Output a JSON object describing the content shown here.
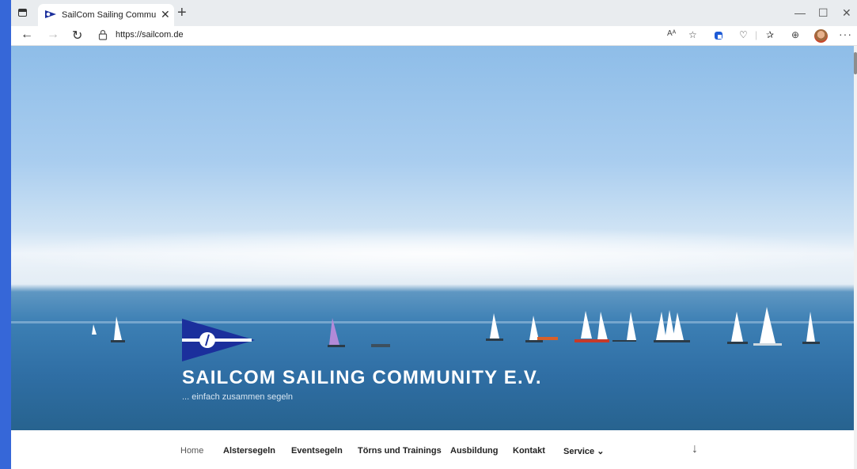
{
  "browser": {
    "tab_title": "SailCom Sailing Community e.V.",
    "tab_close": "✕",
    "new_tab": "+",
    "window_controls": {
      "minimize": "—",
      "maximize": "☐",
      "close": "✕"
    },
    "url": "https://sailcom.de",
    "read_aloud": "Aᴬ",
    "more": "···"
  },
  "hero": {
    "site_title": "SAILCOM SAILING COMMUNITY E.V.",
    "tagline": "... einfach zusammen segeln"
  },
  "nav": {
    "items": [
      {
        "label": "Home"
      },
      {
        "label": "Alstersegeln"
      },
      {
        "label": "Eventsegeln"
      },
      {
        "label": "Törns und Trainings"
      },
      {
        "label": "Ausbildung"
      },
      {
        "label": "Kontakt"
      },
      {
        "label": "Service ⌄"
      }
    ],
    "scroll_down": "↓"
  },
  "colors": {
    "desktop_bg": "#3667d8",
    "logo_blue": "#1b2f9c",
    "site_title": "#ffffff"
  }
}
